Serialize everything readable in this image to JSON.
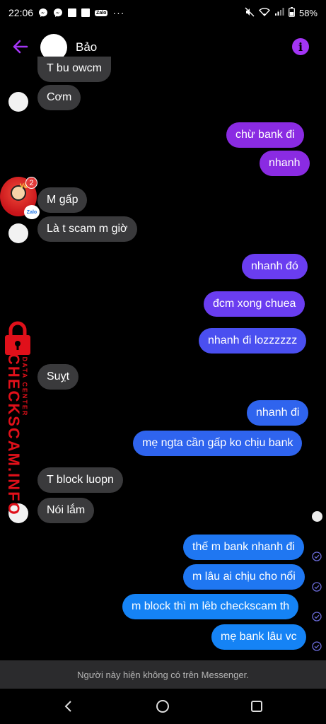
{
  "status_bar": {
    "time": "22:06",
    "notification_icons": [
      "messenger-icon",
      "messenger-icon",
      "square-icon",
      "square-icon",
      "zalo-icon"
    ],
    "zalo_label": "Zalo",
    "more": "···",
    "battery": "58%"
  },
  "header": {
    "name": "Bảo"
  },
  "messages": [
    {
      "dir": "in",
      "text": "T bu owcm"
    },
    {
      "dir": "in",
      "text": "Cơm"
    },
    {
      "dir": "out",
      "text": "chừ  bank đi"
    },
    {
      "dir": "out",
      "text": "nhanh"
    },
    {
      "dir": "in",
      "text": "M gấp"
    },
    {
      "dir": "in",
      "text": "Là t scam m giờ"
    },
    {
      "dir": "out",
      "text": "nhanh đó"
    },
    {
      "dir": "out",
      "text": "đcm xong chuea"
    },
    {
      "dir": "out",
      "text": "nhanh đi lozzzzzz"
    },
    {
      "dir": "in",
      "text": "Suỵt"
    },
    {
      "dir": "out",
      "text": "nhanh đi"
    },
    {
      "dir": "out",
      "text": "mẹ ngta cần gấp ko chịu bank"
    },
    {
      "dir": "in",
      "text": "T block luopn"
    },
    {
      "dir": "in",
      "text": "Nói lắm"
    },
    {
      "dir": "out",
      "text": "thế m bank nhanh đi"
    },
    {
      "dir": "out",
      "text": "m lâu ai chịu cho nổi"
    },
    {
      "dir": "out",
      "text": "m block thì m lêb checkscam th"
    },
    {
      "dir": "out",
      "text": "mẹ bank lâu vc"
    }
  ],
  "zalo_bubble": {
    "badge_count": "2",
    "logo": "Zalo",
    "pic_text": "Về ăn"
  },
  "watermark": {
    "site": "CHECKSCAM.INFO",
    "sub": "DATA CENTER"
  },
  "footer": {
    "notice": "Người này hiện không có trên Messenger."
  },
  "colors": {
    "accent": "#a335f5",
    "incoming": "#3a3a3c",
    "watermark": "#e0101a"
  }
}
